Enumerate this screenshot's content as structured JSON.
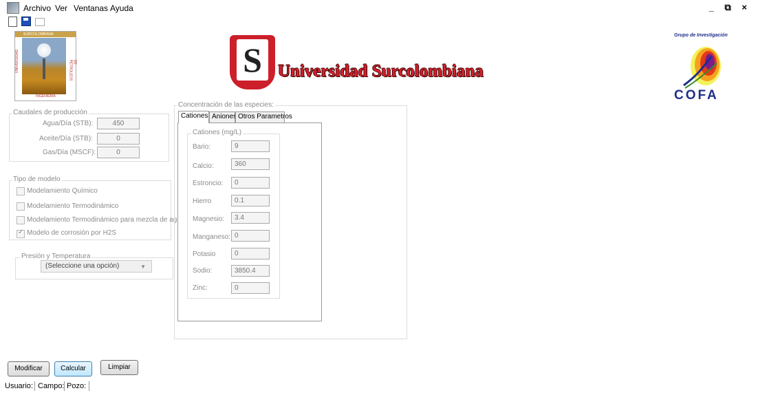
{
  "menu": {
    "items": [
      "Archivo",
      "Ver",
      "Ventanas",
      "Ayuda"
    ],
    "window_controls": "_ ⧉ ×"
  },
  "toolbar": {
    "icons": [
      "new-document-icon",
      "save-icon",
      "print-icon"
    ]
  },
  "logos": {
    "left_top_text": "SURCOLOMBIANA",
    "left_side_text": "UNIVERSIDAD",
    "left_right_text": "DE PETROLEOS",
    "left_bottom_text": "INGENIERIA",
    "university_name": "Universidad Surcolombiana",
    "cofa_group": "Grupo de Investigación",
    "cofa_word": "COFA"
  },
  "production": {
    "title": "Caudales de producción",
    "fields": [
      {
        "label": "Agua/Día (STB):",
        "value": "450"
      },
      {
        "label": "Aceite/Día (STB):",
        "value": "0"
      },
      {
        "label": "Gas/Día (MSCF):",
        "value": "0"
      }
    ]
  },
  "model_type": {
    "title": "Tipo de modelo",
    "options": [
      {
        "label": "Modelamiento Químico",
        "checked": false
      },
      {
        "label": "Modelamiento Termodinámico",
        "checked": false
      },
      {
        "label": "Modelamiento Termodinámico para mezcla de aguas",
        "checked": false
      },
      {
        "label": "Modelo de corrosión por H2S",
        "checked": true
      }
    ]
  },
  "pressure_temp": {
    "title": "Presión y Temperatura",
    "selected": "(Seleccione una opción)"
  },
  "species": {
    "title": "Concentración de las especies:",
    "tabs": [
      "Cationes",
      "Aniones",
      "Otros Parametros"
    ],
    "active_tab": "Cationes",
    "cations_title": "Cationes (mg/L)",
    "cations": [
      {
        "label": "Bario:",
        "value": "9"
      },
      {
        "label": "Calcio:",
        "value": "360"
      },
      {
        "label": "Estroncio:",
        "value": "0"
      },
      {
        "label": "Hierro",
        "value": "0.1"
      },
      {
        "label": "Magnesio:",
        "value": "3.4"
      },
      {
        "label": "Manganeso:",
        "value": "0"
      },
      {
        "label": "Potasio",
        "value": "0"
      },
      {
        "label": "Sodio:",
        "value": "3850.4"
      },
      {
        "label": "Zinc:",
        "value": "0"
      }
    ]
  },
  "buttons": {
    "modify": "Modificar",
    "calculate": "Calcular",
    "clear": "Limpiar"
  },
  "status": {
    "user": "Usuario:",
    "field": "Campo:",
    "well": "Pozo:"
  }
}
